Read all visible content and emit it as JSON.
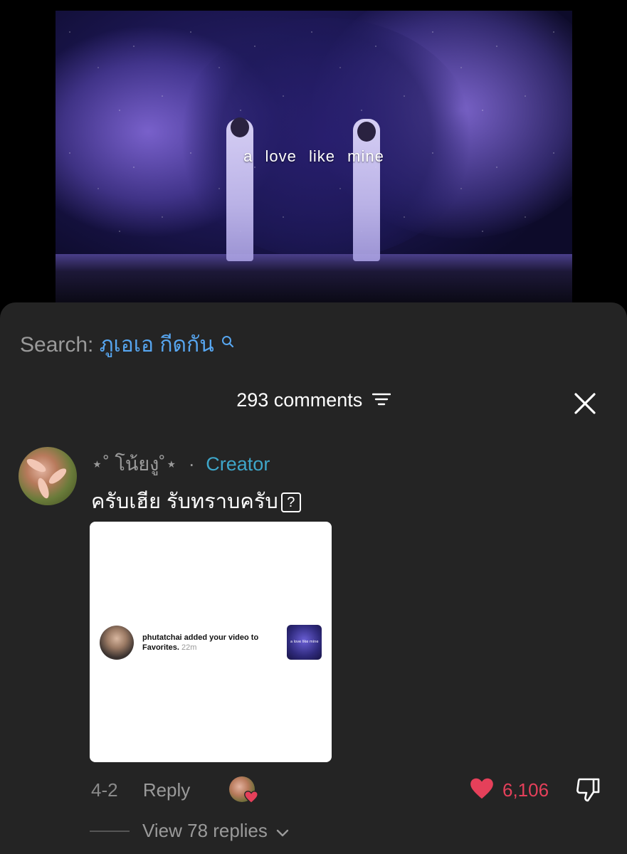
{
  "video": {
    "caption": "a love like mine"
  },
  "search": {
    "label": "Search:",
    "query": "ภูเอเอ กีดกัน"
  },
  "comments_header": {
    "count_label": "293 comments"
  },
  "comment": {
    "author": "⋆˚ โน้ยงู˚⋆",
    "separator": "·",
    "role": "Creator",
    "text": "ครับเฮีย รับทราบครับ",
    "qmark": "?",
    "attachment": {
      "notification_text": "phutatchai added your video to Favorites.",
      "time": "22m",
      "thumb_caption": "a love like mine"
    },
    "date": "4-2",
    "reply_label": "Reply",
    "likes": "6,106",
    "view_replies_label": "View 78 replies"
  },
  "colors": {
    "sheet_bg": "#242424",
    "search_query": "#57a6f0",
    "creator": "#3ea6c9",
    "like": "#e5405a"
  }
}
